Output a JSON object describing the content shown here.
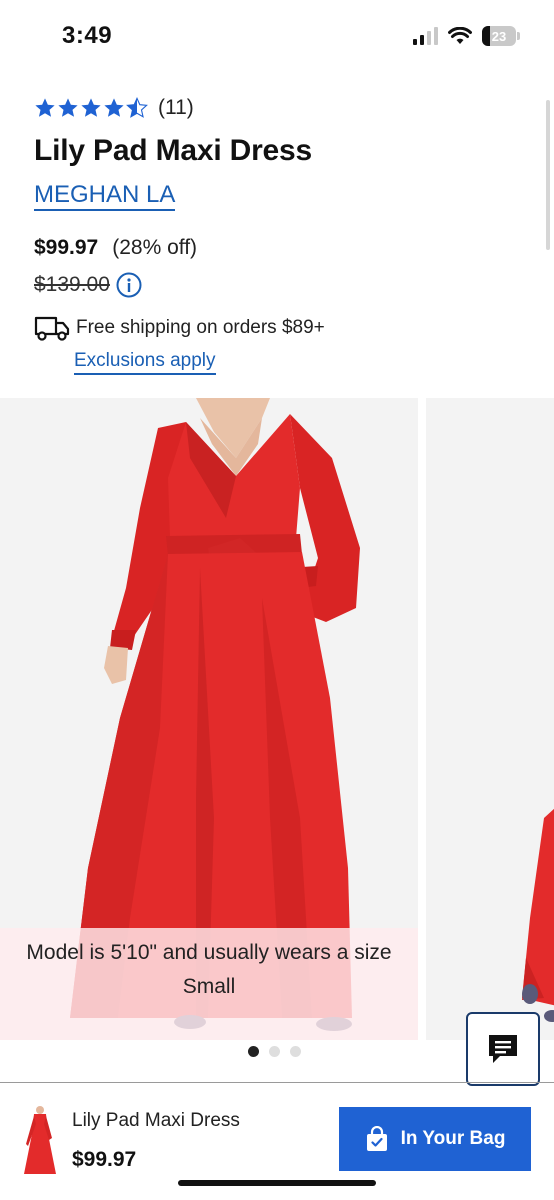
{
  "status_bar": {
    "time": "3:49",
    "battery_level": "23"
  },
  "product": {
    "rating": 4.5,
    "review_count": "(11)",
    "title": "Lily Pad Maxi Dress",
    "brand": "MEGHAN LA",
    "sale_price": "$99.97",
    "discount": "(28% off)",
    "original_price": "$139.00",
    "shipping_text": "Free shipping on orders $89+",
    "exclusions_link": "Exclusions apply"
  },
  "gallery": {
    "caption": "Model is 5'10\" and usually wears a size Small",
    "dot_count": 3,
    "active_dot": 0
  },
  "bottom_bar": {
    "title": "Lily Pad Maxi Dress",
    "price": "$99.97",
    "bag_button_label": "In Your Bag"
  },
  "colors": {
    "link_blue": "#1a5fb4",
    "star_blue": "#1f62d3",
    "button_blue": "#1f62d3",
    "dress_red": "#e32b2b"
  },
  "icons": [
    "star-icon",
    "info-icon",
    "truck-icon",
    "chat-icon",
    "shopping-bag-icon",
    "wifi-icon",
    "signal-icon",
    "battery-icon"
  ]
}
